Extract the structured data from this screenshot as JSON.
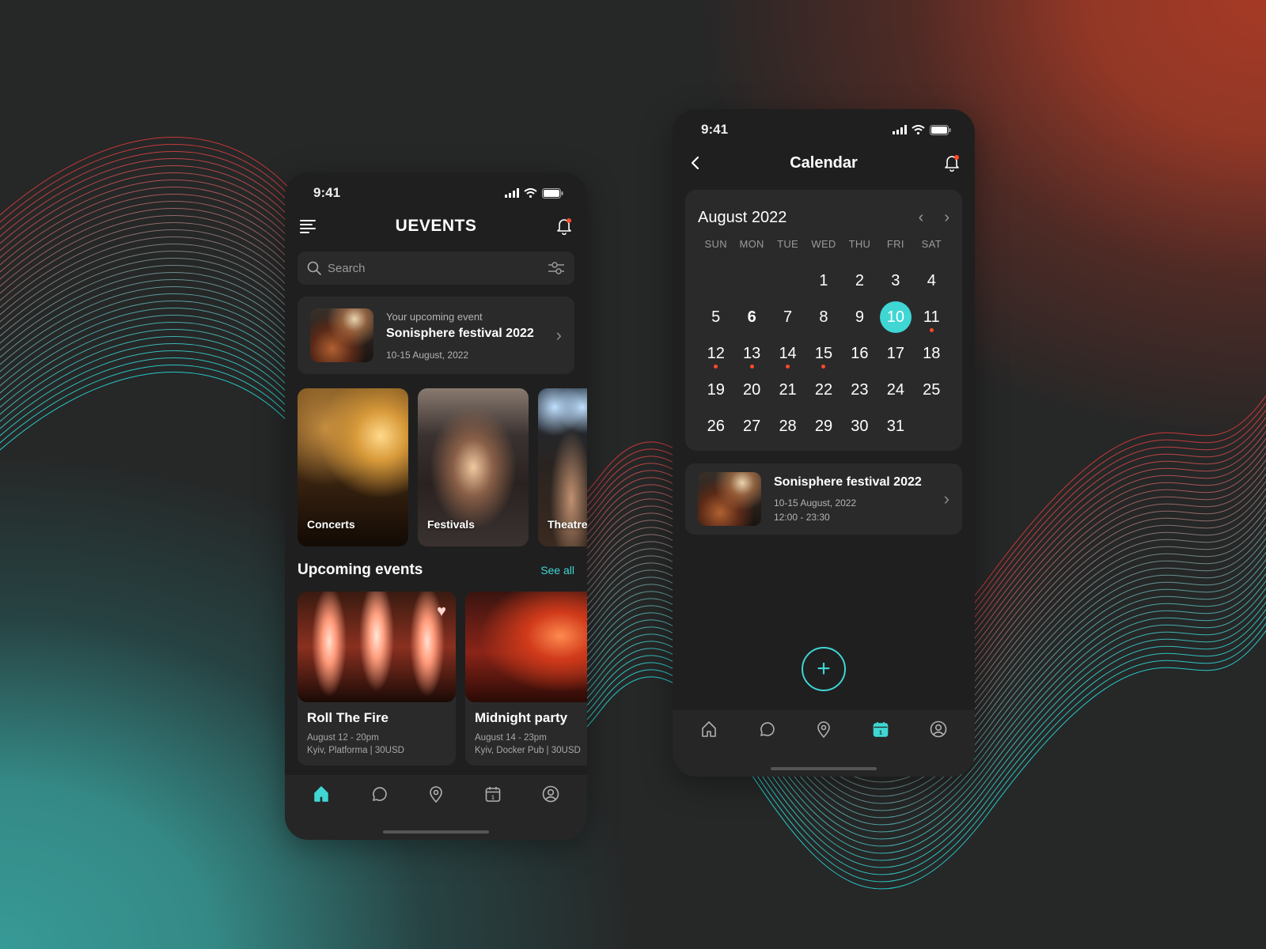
{
  "colors": {
    "accent": "#3fd6d4",
    "event_dot": "#ff4a2a",
    "notification_dot": "#ff4a2a",
    "phone_bg": "#1f1f1f",
    "card_bg": "#2a2a2a"
  },
  "home": {
    "status": {
      "time": "9:41",
      "icons": [
        "signal-icon",
        "wifi-icon",
        "battery-icon"
      ]
    },
    "header": {
      "title": "UEVENTS",
      "left_icon": "menu-icon",
      "right_icon": "bell-icon"
    },
    "search": {
      "placeholder": "Search",
      "value": "",
      "filter_icon": "filter-sliders-icon"
    },
    "upcoming": {
      "label": "Your upcoming event",
      "title": "Sonisphere festival 2022",
      "date": "10-15 August, 2022"
    },
    "categories": [
      {
        "label": "Concerts"
      },
      {
        "label": "Festivals"
      },
      {
        "label": "Theatre"
      }
    ],
    "upcoming_section": {
      "title": "Upcoming events",
      "see_all": "See all"
    },
    "events": [
      {
        "title": "Roll The Fire",
        "date": "August 12  -  20pm",
        "location": "Kyiv, Platforma  |  30USD",
        "favorite": true
      },
      {
        "title": "Midnight party",
        "date": "August 14  -  23pm",
        "location": "Kyiv, Docker Pub  |  30USD",
        "favorite": false
      }
    ],
    "tabbar": [
      {
        "name": "home",
        "active": true
      },
      {
        "name": "chat",
        "active": false
      },
      {
        "name": "location",
        "active": false
      },
      {
        "name": "calendar",
        "active": false
      },
      {
        "name": "profile",
        "active": false
      }
    ]
  },
  "calendar": {
    "status": {
      "time": "9:41"
    },
    "header": {
      "title": "Calendar",
      "back_icon": "chevron-left-icon",
      "right_icon": "bell-icon"
    },
    "month_label": "August 2022",
    "weekdays": [
      "SUN",
      "MON",
      "TUE",
      "WED",
      "THU",
      "FRI",
      "SAT"
    ],
    "leading_blanks": 3,
    "days_in_month": 31,
    "selected_day": 10,
    "bold_days": [
      6
    ],
    "event_days": [
      11,
      12,
      13,
      14,
      15
    ],
    "event": {
      "title": "Sonisphere festival 2022",
      "date": "10-15 August, 2022",
      "time": "12:00 - 23:30"
    },
    "add_button": "+",
    "tabbar": [
      {
        "name": "home",
        "active": false
      },
      {
        "name": "chat",
        "active": false
      },
      {
        "name": "location",
        "active": false
      },
      {
        "name": "calendar",
        "active": true
      },
      {
        "name": "profile",
        "active": false
      }
    ]
  }
}
